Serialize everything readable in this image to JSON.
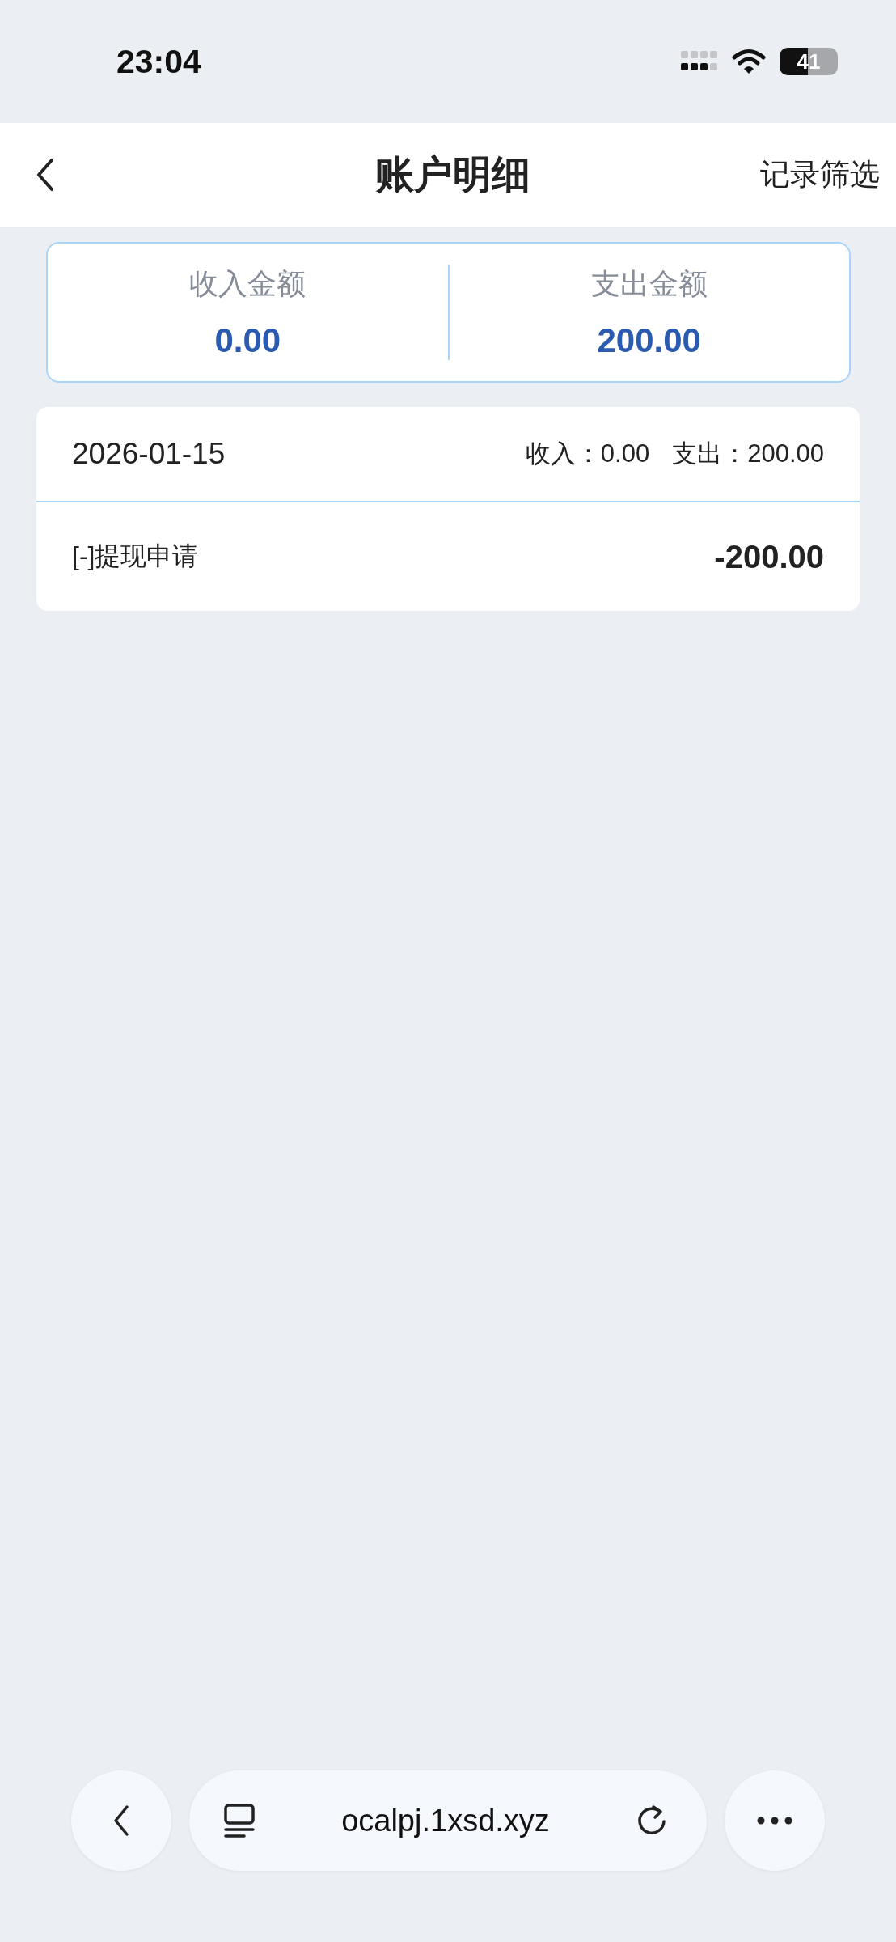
{
  "status_bar": {
    "time": "23:04",
    "battery": "41"
  },
  "nav": {
    "title": "账户明细",
    "action": "记录筛选"
  },
  "summary": [
    {
      "label": "收入金额",
      "value": "0.00"
    },
    {
      "label": "支出金额",
      "value": "200.00"
    }
  ],
  "days": [
    {
      "date": "2026-01-15",
      "income_label": "收入：",
      "income": "0.00",
      "expense_label": "支出：",
      "expense": "200.00",
      "entries": [
        {
          "title": "[-]提现申请",
          "amount": "-200.00"
        }
      ]
    }
  ],
  "browser": {
    "url": "ocalpj.1xsd.xyz"
  }
}
